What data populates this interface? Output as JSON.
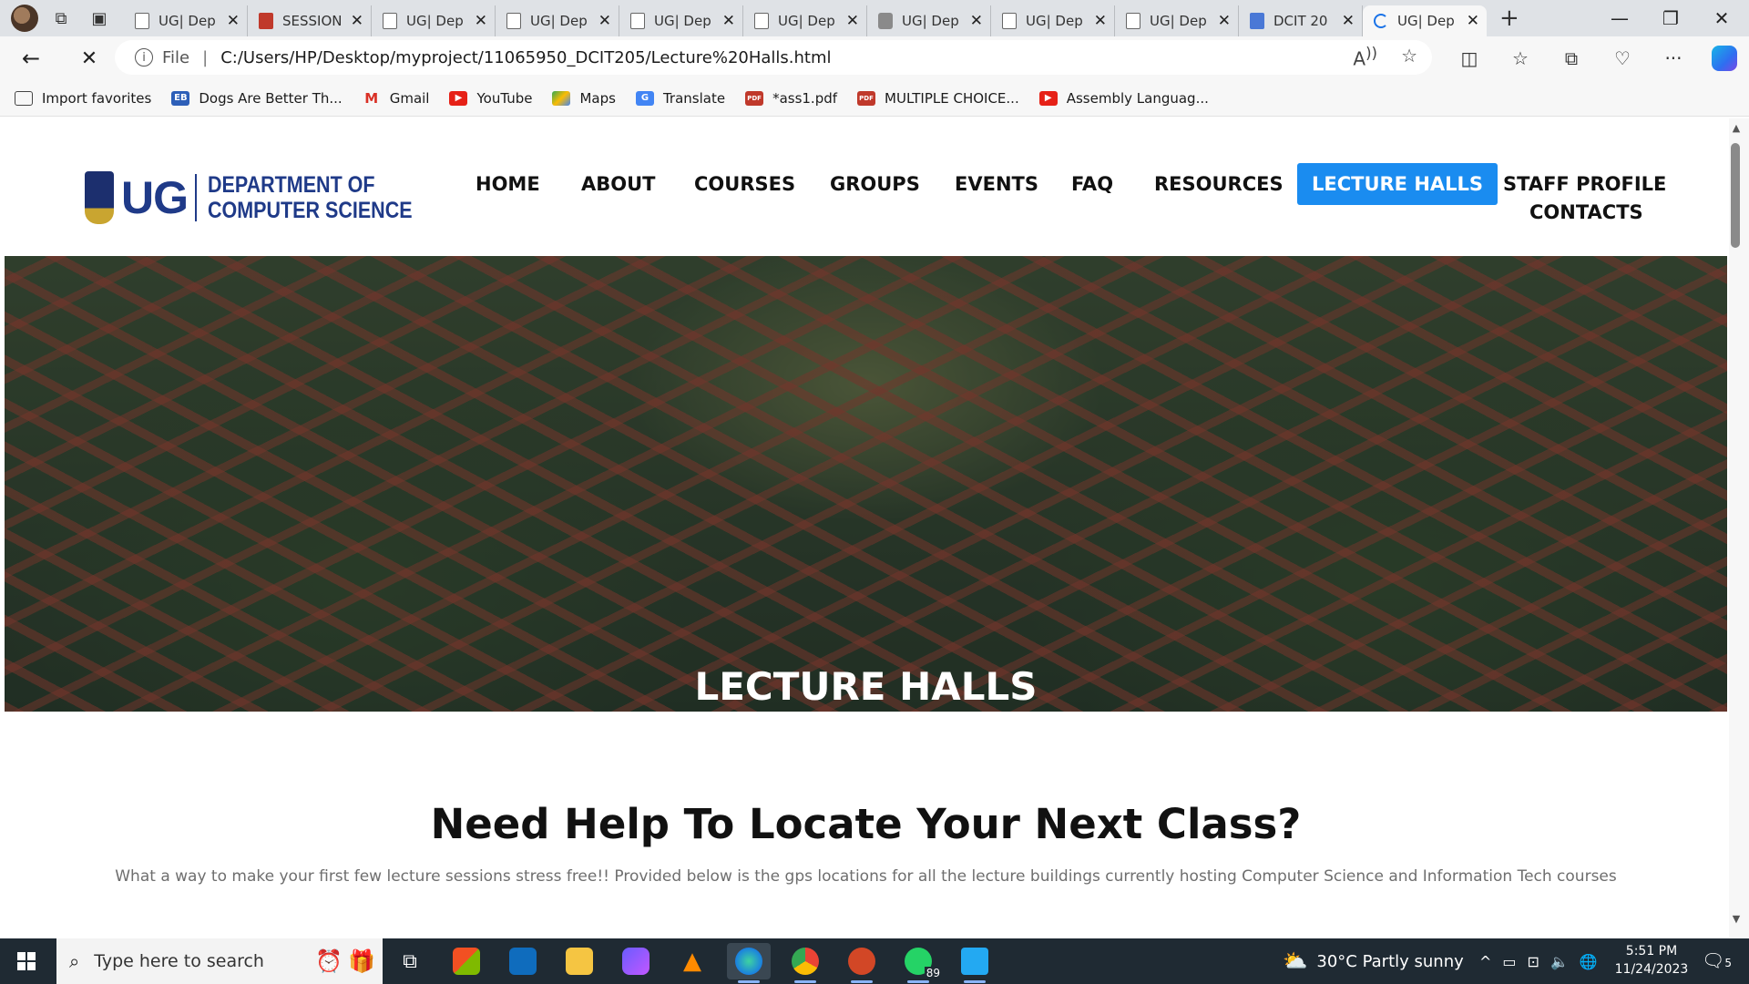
{
  "browser": {
    "tabs": [
      {
        "title": "UG| Dep",
        "icon": "page-icon"
      },
      {
        "title": "SESSION",
        "icon": "pdf-icon"
      },
      {
        "title": "UG| Dep",
        "icon": "page-icon"
      },
      {
        "title": "UG| Dep",
        "icon": "page-icon"
      },
      {
        "title": "UG| Dep",
        "icon": "page-icon"
      },
      {
        "title": "UG| Dep",
        "icon": "page-icon"
      },
      {
        "title": "UG| Dep",
        "icon": "shield-icon"
      },
      {
        "title": "UG| Dep",
        "icon": "page-icon"
      },
      {
        "title": "UG| Dep",
        "icon": "page-icon"
      },
      {
        "title": "DCIT 20",
        "icon": "doc-icon"
      },
      {
        "title": "UG| Dep",
        "icon": "loading-icon",
        "active": true
      }
    ],
    "address": {
      "scheme": "File",
      "url": "C:/Users/HP/Desktop/myproject/11065950_DCIT205/Lecture%20Halls.html"
    },
    "favorites": [
      {
        "label": "Import favorites",
        "icon": "import-icon"
      },
      {
        "label": "Dogs Are Better Th...",
        "icon": "eb-icon"
      },
      {
        "label": "Gmail",
        "icon": "gmail-icon"
      },
      {
        "label": "YouTube",
        "icon": "youtube-icon"
      },
      {
        "label": "Maps",
        "icon": "maps-icon"
      },
      {
        "label": "Translate",
        "icon": "translate-icon"
      },
      {
        "label": "*ass1.pdf",
        "icon": "pdf-icon"
      },
      {
        "label": "MULTIPLE CHOICE...",
        "icon": "pdf-icon"
      },
      {
        "label": "Assembly Languag...",
        "icon": "youtube-icon"
      }
    ]
  },
  "site": {
    "logo": {
      "short": "UG",
      "line1": "DEPARTMENT OF",
      "line2": "COMPUTER SCIENCE"
    },
    "nav": [
      "HOME",
      "ABOUT",
      "COURSES",
      "GROUPS",
      "EVENTS",
      "FAQ",
      "RESOURCES",
      "LECTURE HALLS",
      "STAFF PROFILE",
      "CONTACTS"
    ],
    "active_nav": "LECTURE HALLS",
    "hero_title": "LECTURE HALLS",
    "help_title": "Need Help To Locate Your Next Class?",
    "help_text": "What a way to make your first few lecture sessions stress free!! Provided below is the gps locations for all the lecture buildings currently hosting Computer Science and Information Tech courses"
  },
  "taskbar": {
    "search_placeholder": "Type here to search",
    "whatsapp_badge": "89",
    "weather": "30°C  Partly sunny",
    "time": "5:51 PM",
    "date": "11/24/2023",
    "notifications": "5"
  },
  "colors": {
    "accent": "#1a8cf0",
    "logo_blue": "#1f3a88",
    "taskbar": "#1f2a33"
  }
}
